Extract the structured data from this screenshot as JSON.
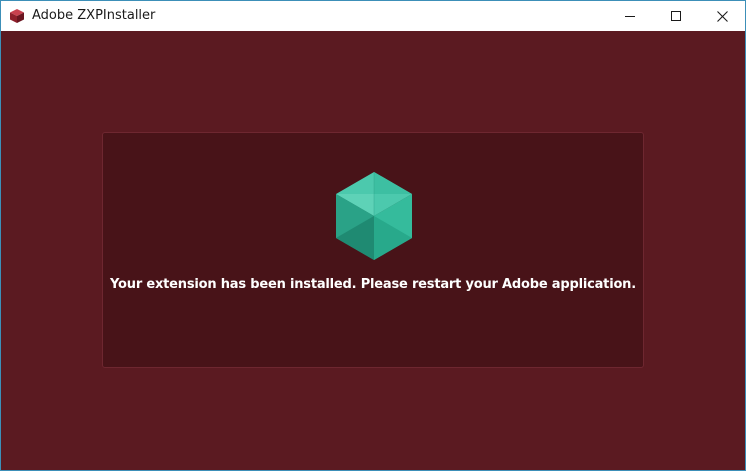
{
  "window": {
    "title": "Adobe ZXPInstaller",
    "icon": "zxpinstaller-app-icon",
    "controls": {
      "minimize_icon": "minimize-icon",
      "maximize_icon": "maximize-icon",
      "close_icon": "close-icon"
    }
  },
  "main": {
    "status_icon": "cube-icon",
    "message": "Your extension has been installed. Please restart your Adobe application."
  },
  "colors": {
    "background": "#5b1a21",
    "panel": "#481318",
    "cube": "#2fb596",
    "titlebar": "#ffffff"
  }
}
